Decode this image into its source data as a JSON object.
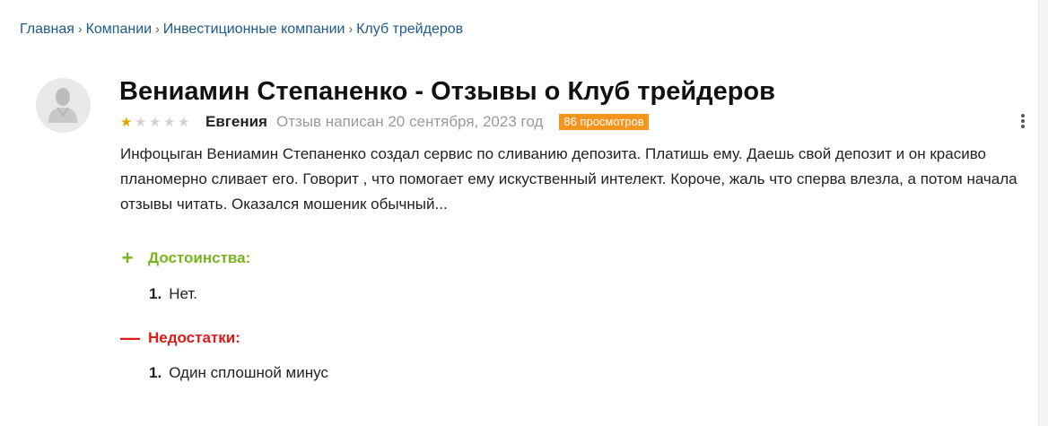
{
  "breadcrumb": {
    "items": [
      "Главная",
      "Компании",
      "Инвестиционные компании",
      "Клуб трейдеров"
    ],
    "separator": "›"
  },
  "review": {
    "title": "Вениамин Степаненко - Отзывы о Клуб трейдеров",
    "rating": 1,
    "rating_max": 5,
    "author": "Евгения",
    "date": "Отзыв написан 20 сентября, 2023 год",
    "views": "86 просмотров",
    "text": "Инфоцыган Вениамин Степаненко создал сервис по сливанию депозита. Платишь ему. Даешь свой депозит и он красиво планомерно сливает его. Говорит , что помогает ему искуственный интелект. Короче, жаль что сперва влезла, а потом начала отзывы читать. Оказался мошеник обычный..."
  },
  "pros": {
    "heading": "Достоинства:",
    "sign": "+",
    "items": [
      {
        "num": "1.",
        "text": "Нет."
      }
    ]
  },
  "cons": {
    "heading": "Недостатки:",
    "sign": "—",
    "items": [
      {
        "num": "1.",
        "text": "Один сплошной минус"
      }
    ]
  },
  "colors": {
    "link": "#1d5a8e",
    "pros": "#78b41e",
    "cons": "#d91c1c",
    "views_badge": "#f7941d",
    "star_on": "#e6a100",
    "star_off": "#d2d2d2"
  },
  "icons": {
    "avatar": "user-silhouette-icon",
    "menu": "kebab-menu-icon",
    "star": "star-icon"
  }
}
